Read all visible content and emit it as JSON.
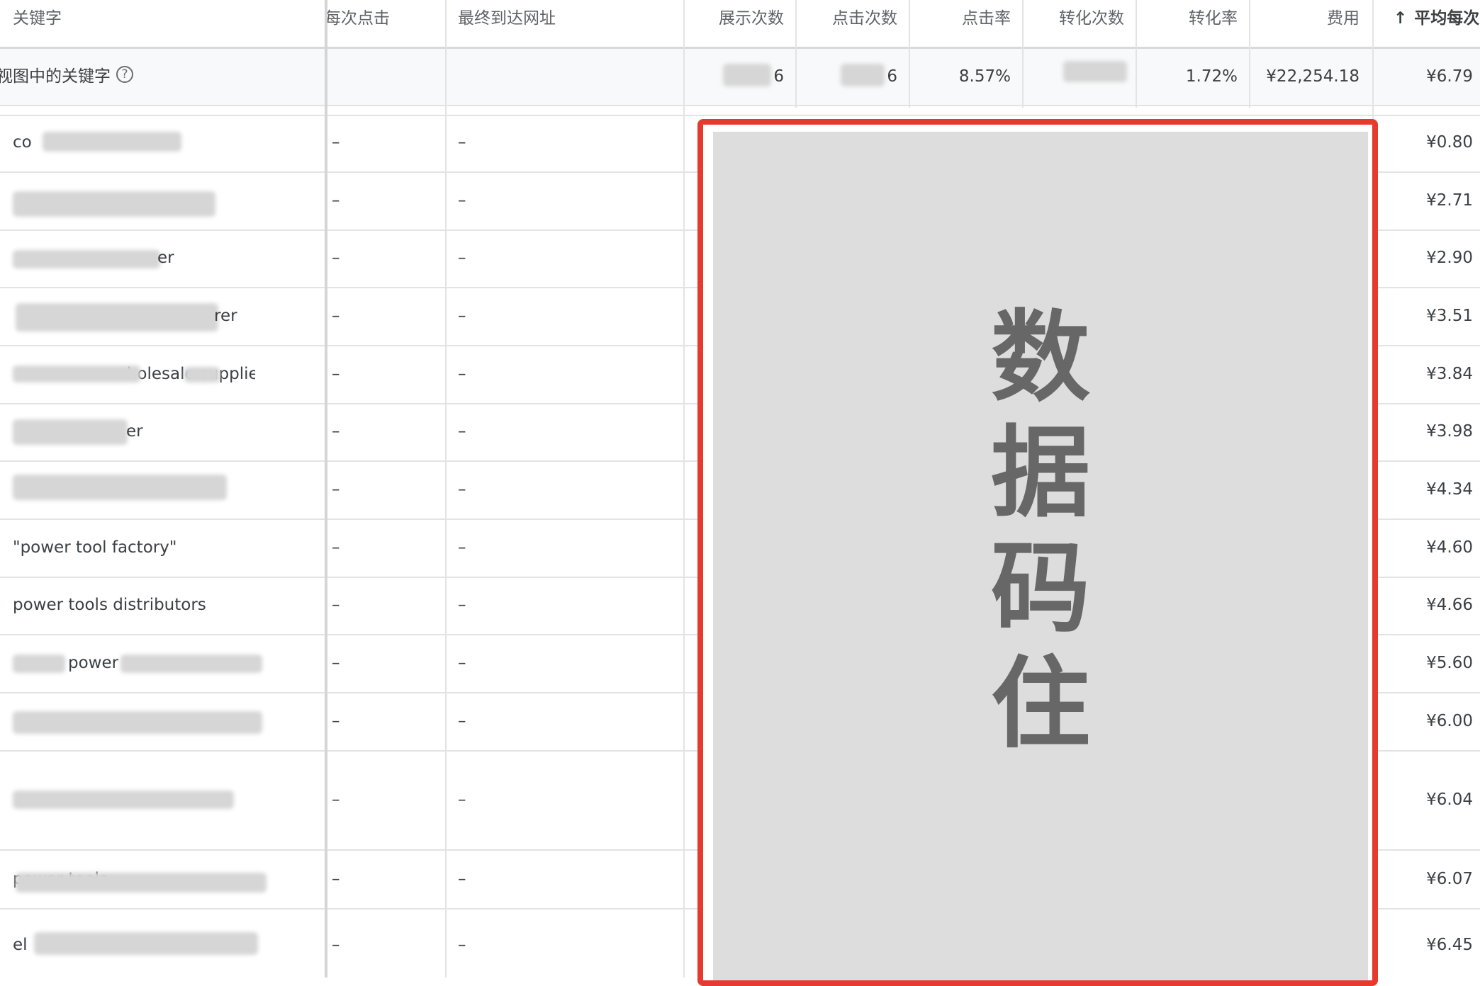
{
  "header": {
    "keyword": "关键字",
    "max_cpc": "每次点击",
    "final_url": "最终到达网址",
    "impressions": "展示次数",
    "clicks": "点击次数",
    "ctr": "点击率",
    "conversions": "转化次数",
    "conv_rate": "转化率",
    "cost": "费用",
    "avg_cpc": "平均每次",
    "sort_icon": "arrow-up-icon"
  },
  "summary": {
    "label": "视图中的关键字",
    "impressions": "6",
    "clicks": "6",
    "ctr": "8.57%",
    "conv_rate": "1.72%",
    "cost": "¥22,254.18",
    "avg_cpc": "¥6.79",
    "help_icon": "help-circle-icon"
  },
  "rows": [
    {
      "keyword": "co",
      "max_cpc": "–",
      "final_url": "–",
      "avg_cpc": "¥0.80"
    },
    {
      "keyword": "",
      "max_cpc": "–",
      "final_url": "–",
      "avg_cpc": "¥2.71"
    },
    {
      "keyword": "er",
      "max_cpc": "–",
      "final_url": "–",
      "avg_cpc": "¥2.90"
    },
    {
      "keyword": "rer",
      "max_cpc": "–",
      "final_url": "–",
      "avg_cpc": "¥3.51"
    },
    {
      "keyword": "wholesale suppliers",
      "max_cpc": "–",
      "final_url": "–",
      "avg_cpc": "¥3.84"
    },
    {
      "keyword": "er",
      "max_cpc": "–",
      "final_url": "–",
      "avg_cpc": "¥3.98"
    },
    {
      "keyword": "",
      "max_cpc": "–",
      "final_url": "–",
      "avg_cpc": "¥4.34"
    },
    {
      "keyword": "\"power tool factory\"",
      "max_cpc": "–",
      "final_url": "–",
      "avg_cpc": "¥4.60"
    },
    {
      "keyword": "power tools distributors",
      "max_cpc": "–",
      "final_url": "–",
      "avg_cpc": "¥4.66"
    },
    {
      "keyword": "power",
      "max_cpc": "–",
      "final_url": "–",
      "avg_cpc": "¥5.60"
    },
    {
      "keyword": "",
      "max_cpc": "–",
      "final_url": "–",
      "avg_cpc": "¥6.00"
    },
    {
      "keyword": "",
      "max_cpc": "–",
      "final_url": "–",
      "avg_cpc": "¥6.04"
    },
    {
      "keyword": "power tools",
      "max_cpc": "–",
      "final_url": "–",
      "avg_cpc": "¥6.07"
    },
    {
      "keyword": "el",
      "max_cpc": "–",
      "final_url": "–",
      "avg_cpc": "¥6.45"
    }
  ],
  "overlay": {
    "char1": "数",
    "char2": "据",
    "char3": "码",
    "char4": "住",
    "border_color": "#e53b2e",
    "fill_color": "#dcdddc"
  }
}
